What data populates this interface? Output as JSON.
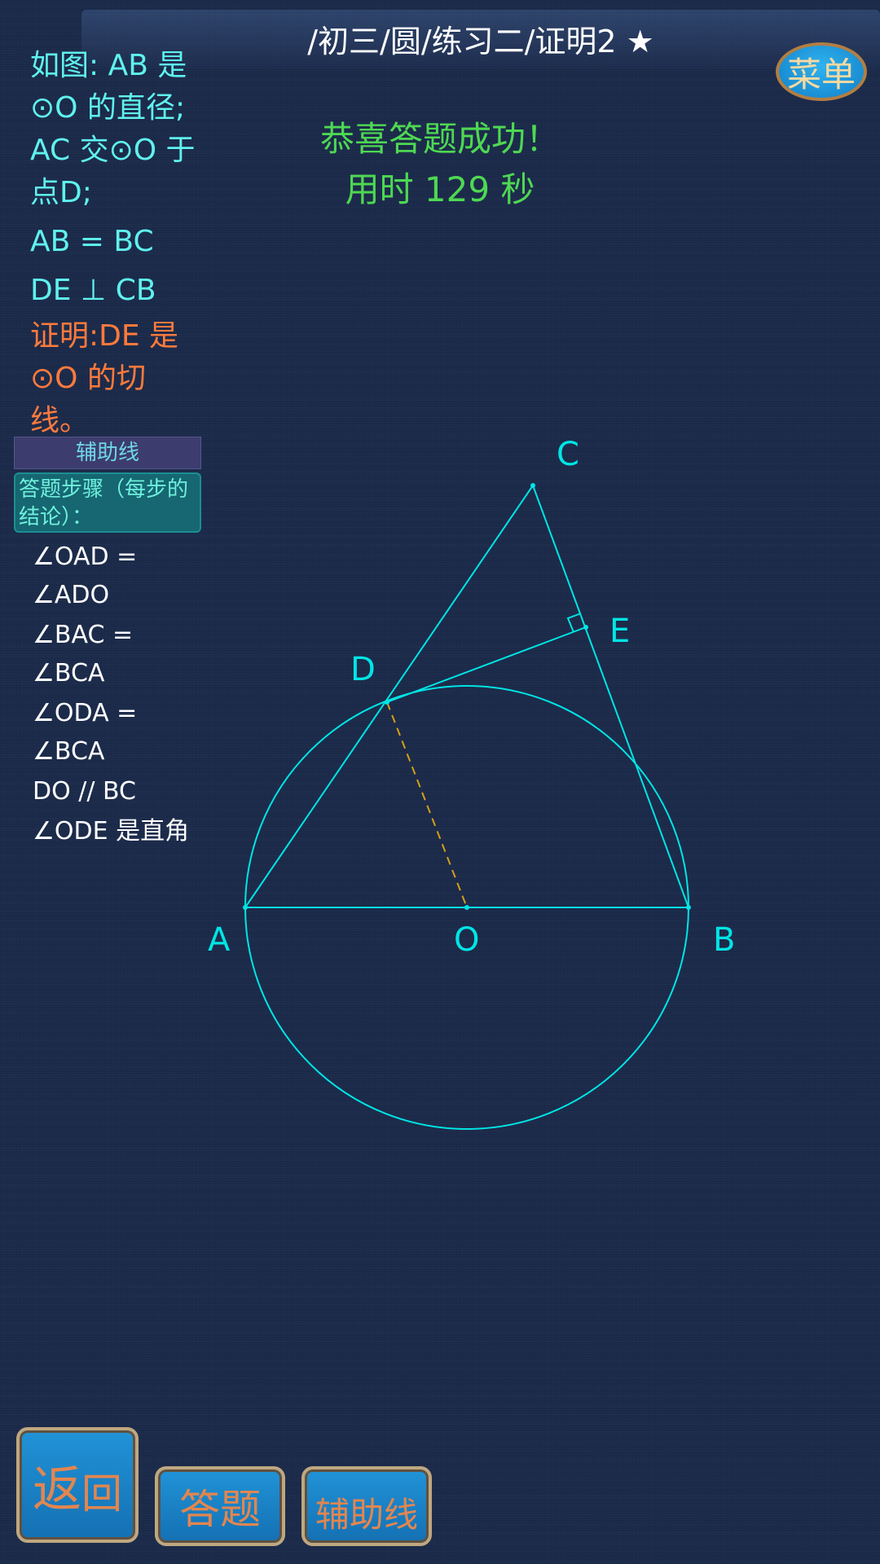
{
  "header": {
    "title": "/初三/圆/练习二/证明2 ★",
    "menu_label": "菜单"
  },
  "result": {
    "line1": "恭喜答题成功！",
    "line2": "用时 129 秒"
  },
  "problem": {
    "given": "如图: AB 是⊙O 的直径;AC 交⊙O 于点D;",
    "conditions": [
      "AB  =  BC",
      "DE  ⊥ CB"
    ],
    "goal": "证明:DE 是⊙O 的切线。"
  },
  "panels": {
    "aux_line_label": "辅助线",
    "steps_header": "答题步骤（每步的结论）："
  },
  "steps": [
    "∠OAD  =  ∠ADO",
    "∠BAC  =  ∠BCA",
    "∠ODA  =  ∠BCA",
    "DO  // BC",
    "∠ODE  是直角"
  ],
  "figure": {
    "points": {
      "A": "A",
      "B": "B",
      "C": "C",
      "D": "D",
      "E": "E",
      "O": "O"
    },
    "colors": {
      "primary": "#00e5e5",
      "auxiliary": "#d4a017"
    }
  },
  "buttons": {
    "back": [
      "返",
      "回"
    ],
    "answer": "答题",
    "aux": "辅助线"
  },
  "colors": {
    "background": "#1b2a4a",
    "accent_cyan": "#5ff2ee",
    "goal_orange": "#ff7a3c",
    "success_green": "#4ed852"
  }
}
